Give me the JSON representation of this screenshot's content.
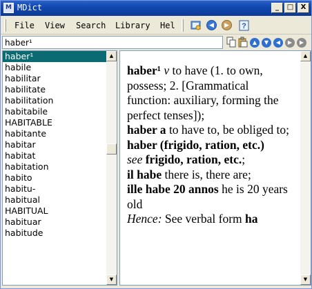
{
  "window": {
    "title": "MDict",
    "minimize_label": "_",
    "maximize_label": "□",
    "close_label": "X"
  },
  "menu": [
    {
      "label": "File"
    },
    {
      "label": "View"
    },
    {
      "label": "Search"
    },
    {
      "label": "Library"
    },
    {
      "label": "Hel"
    }
  ],
  "toolbar_icons": [
    "dictionary-icon",
    "back-icon",
    "forward-icon",
    "help-icon"
  ],
  "search": {
    "value": "haber¹"
  },
  "nav_icons": [
    "copy-icon",
    "paste-icon",
    "up-icon",
    "down-icon",
    "prev-icon",
    "next-icon"
  ],
  "wordlist": [
    {
      "word": "haber¹",
      "selected": true
    },
    {
      "word": "habile"
    },
    {
      "word": "habilitar"
    },
    {
      "word": "habilitate"
    },
    {
      "word": "habilitation"
    },
    {
      "word": "habitabile"
    },
    {
      "word": "HABITABLE"
    },
    {
      "word": "habitante"
    },
    {
      "word": "habitar"
    },
    {
      "word": "habitat"
    },
    {
      "word": "habitation"
    },
    {
      "word": "habito"
    },
    {
      "word": "habitu-"
    },
    {
      "word": "habitual"
    },
    {
      "word": "HABITUAL"
    },
    {
      "word": "habituar"
    },
    {
      "word": "habitude"
    }
  ],
  "definition": {
    "headword": "haber¹",
    "pos": "v",
    "sense_text": " to have (1. to own, possess; 2. [Grammatical function: auxiliary, forming the perfect tenses]);",
    "phrase1": "haber a",
    "phrase1_text": " to have to, be obliged to;",
    "phrase2": "haber (frigido, ration, etc.)",
    "see_label": "see",
    "see_target": "frigido, ration, etc.",
    "see_end": ";",
    "phrase3": "il habe",
    "phrase3_text": " there is, there are;",
    "phrase4": "ille habe 20 annos",
    "phrase4_text": " he is 20 years old",
    "hence_label": "Hence:",
    "hence_text": " See verbal form ",
    "hence_target": "ha"
  },
  "colors": {
    "titlebar": "#1248b0",
    "selection": "#0a6b73",
    "window_face": "#ece9d8"
  }
}
